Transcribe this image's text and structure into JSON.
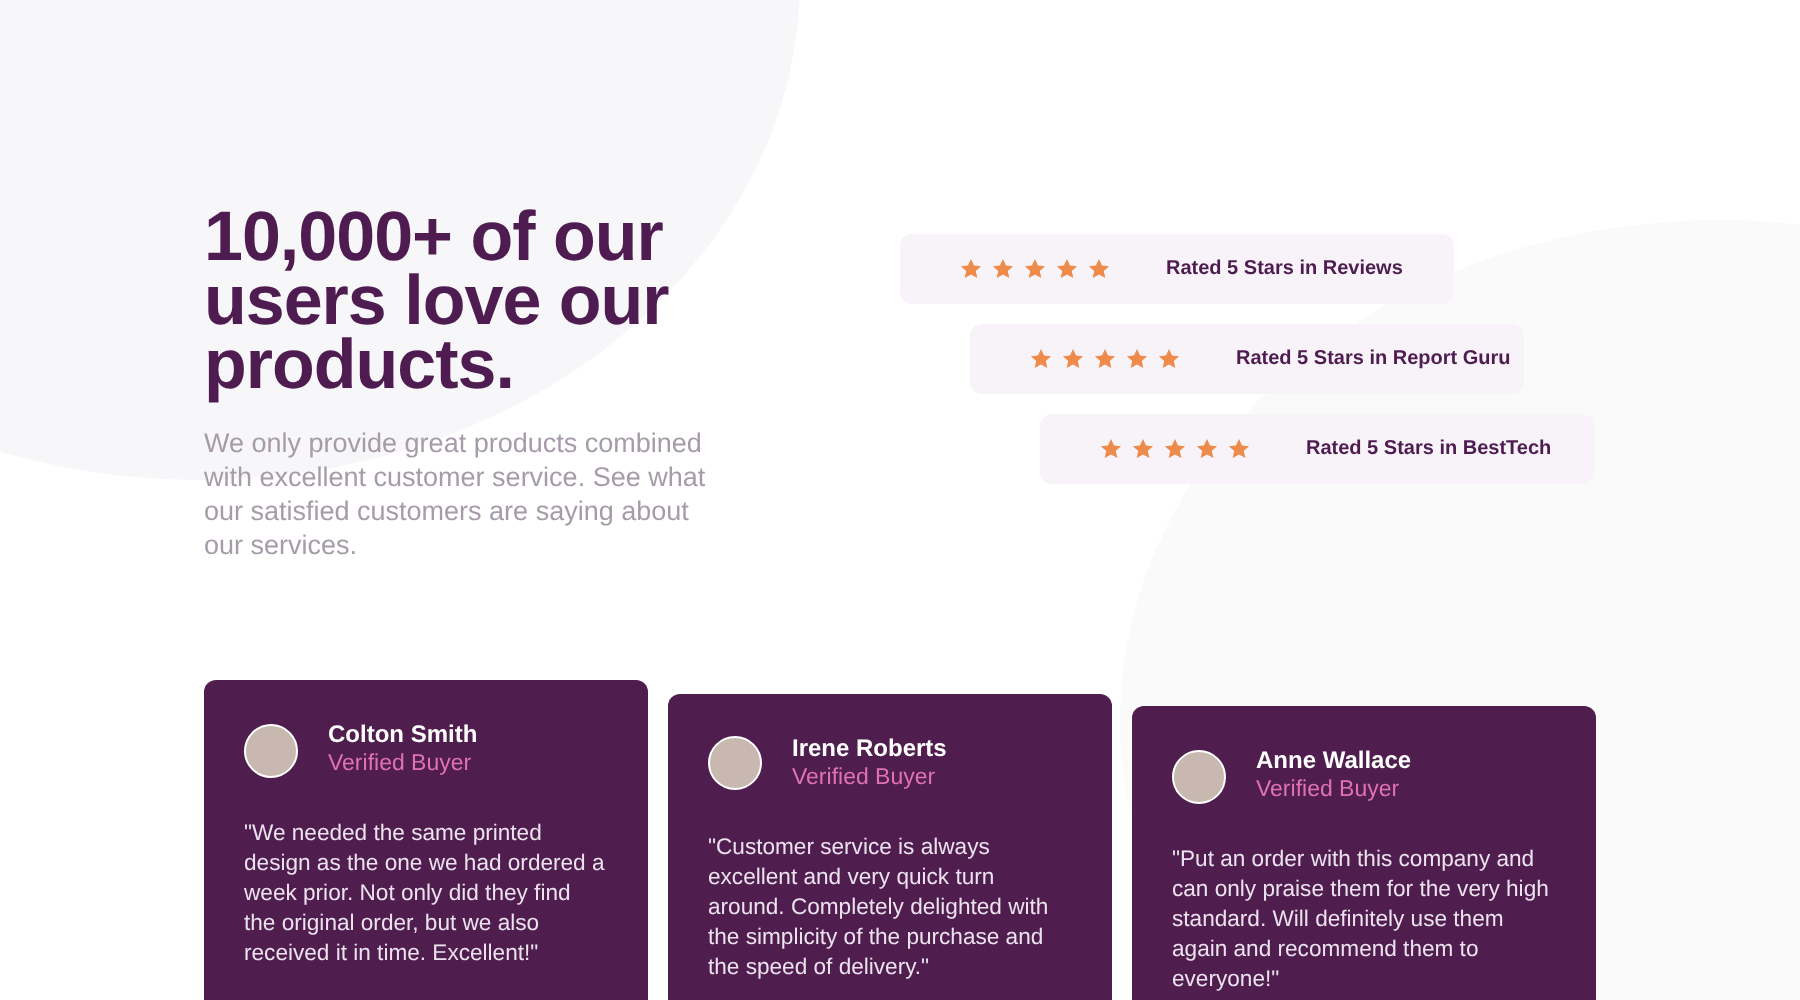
{
  "intro": {
    "heading": "10,000+ of our users love our products.",
    "text": "We only provide great products combined with excellent customer service. See what our satisfied customers are saying about our services."
  },
  "ratings": [
    {
      "stars": 5,
      "label": "Rated 5 Stars in Reviews"
    },
    {
      "stars": 5,
      "label": "Rated 5 Stars in Report Guru"
    },
    {
      "stars": 5,
      "label": "Rated 5 Stars in BestTech"
    }
  ],
  "testimonials": [
    {
      "name": "Colton Smith",
      "role": "Verified Buyer",
      "quote": "\"We needed the same printed design as the one we had ordered a week prior. Not only did they find the original order, but we also received it in time. Excellent!\""
    },
    {
      "name": "Irene Roberts",
      "role": "Verified Buyer",
      "quote": "\"Customer service is always excellent and very quick turn around. Completely delighted with the simplicity of the purchase and the speed of delivery.\""
    },
    {
      "name": "Anne Wallace",
      "role": "Verified Buyer",
      "quote": "\"Put an order with this company and can only praise them for the very high standard. Will definitely use them again and recommend them to everyone!\""
    }
  ]
}
